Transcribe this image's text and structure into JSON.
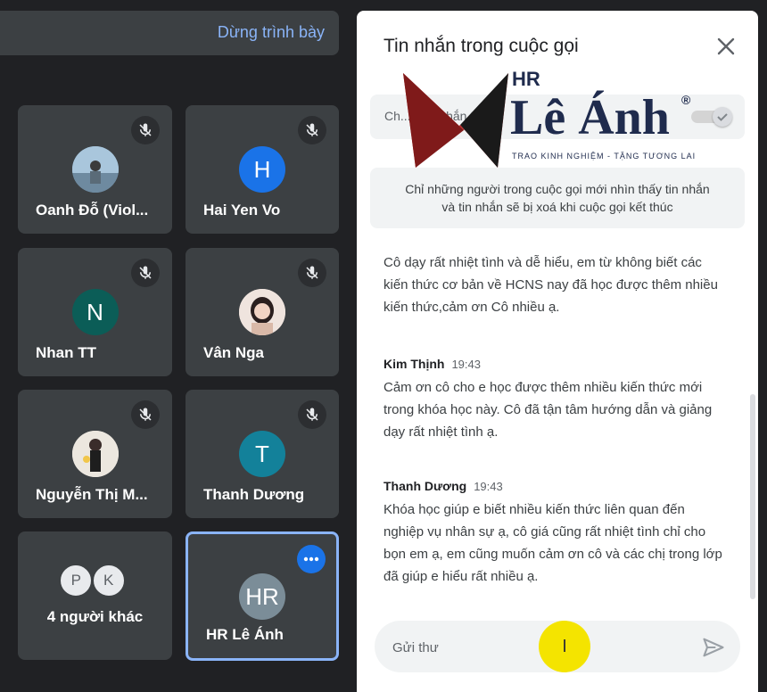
{
  "top_bar": {
    "stop_label": "Dừng trình bày"
  },
  "participants": [
    {
      "name": "Oanh Đỗ (Viol...",
      "initial": "",
      "color": "#7fa9c7",
      "muted": true
    },
    {
      "name": "Hai Yen Vo",
      "initial": "H",
      "color": "#1a73e8",
      "muted": true
    },
    {
      "name": "Nhan TT",
      "initial": "N",
      "color": "#0b5d57",
      "muted": true
    },
    {
      "name": "Vân Nga",
      "initial": "",
      "color": "#d9c3b5",
      "muted": true
    },
    {
      "name": "Nguyễn Thị M...",
      "initial": "",
      "color": "#d8d2c8",
      "muted": true
    },
    {
      "name": "Thanh Dương",
      "initial": "T",
      "color": "#13819a",
      "muted": false
    }
  ],
  "others": {
    "label": "4 người khác",
    "initials": [
      "P",
      "K"
    ]
  },
  "self_tile": {
    "name": "HR Lê Ánh",
    "initial": "HR",
    "color": "#7b8d98"
  },
  "chat": {
    "title": "Tin nhắn trong cuộc gọi",
    "toggle_label": "Ch... ...ời nhắn tin",
    "notice": [
      "Chỉ những người trong cuộc gọi mới nhìn thấy tin nhắn",
      "và tin nhắn sẽ bị xoá khi cuộc gọi kết thúc"
    ],
    "messages": [
      {
        "sender": "",
        "time": "",
        "text": "Cô dạy rất nhiệt tình và dễ hiểu, em từ không biết các kiến thức cơ bản về HCNS nay đã học được thêm nhiều kiến thức,cảm ơn Cô nhiều ạ."
      },
      {
        "sender": "Kim Thịnh",
        "time": "19:43",
        "text": "Cảm ơn cô cho e học được thêm nhiều kiến thức mới trong khóa học này. Cô đã tận tâm hướng dẫn và giảng dạy rất nhiệt tình ạ."
      },
      {
        "sender": "Thanh Dương",
        "time": "19:43",
        "text": "Khóa học giúp e biết nhiều kiến thức liên quan đến nghiệp vụ nhân sự ạ, cô giá cũng rất nhiệt tình chỉ cho bọn em ạ, em cũng muốn cảm ơn cô và các chị trong lớp đã giúp e hiểu rất nhiều ạ."
      }
    ],
    "input_placeholder": "Gửi thư",
    "cursor_glyph": "I"
  },
  "logo": {
    "hr": "HR",
    "brand": "Lê Ánh",
    "reg": "®",
    "slogan": "TRAO KINH NGHIỆM - TẶNG TƯƠNG LAI"
  },
  "colors": {
    "accent": "#8ab4f8",
    "tile_bg": "#3c4043",
    "page_bg": "#202124",
    "cursor": "#f4e400"
  }
}
